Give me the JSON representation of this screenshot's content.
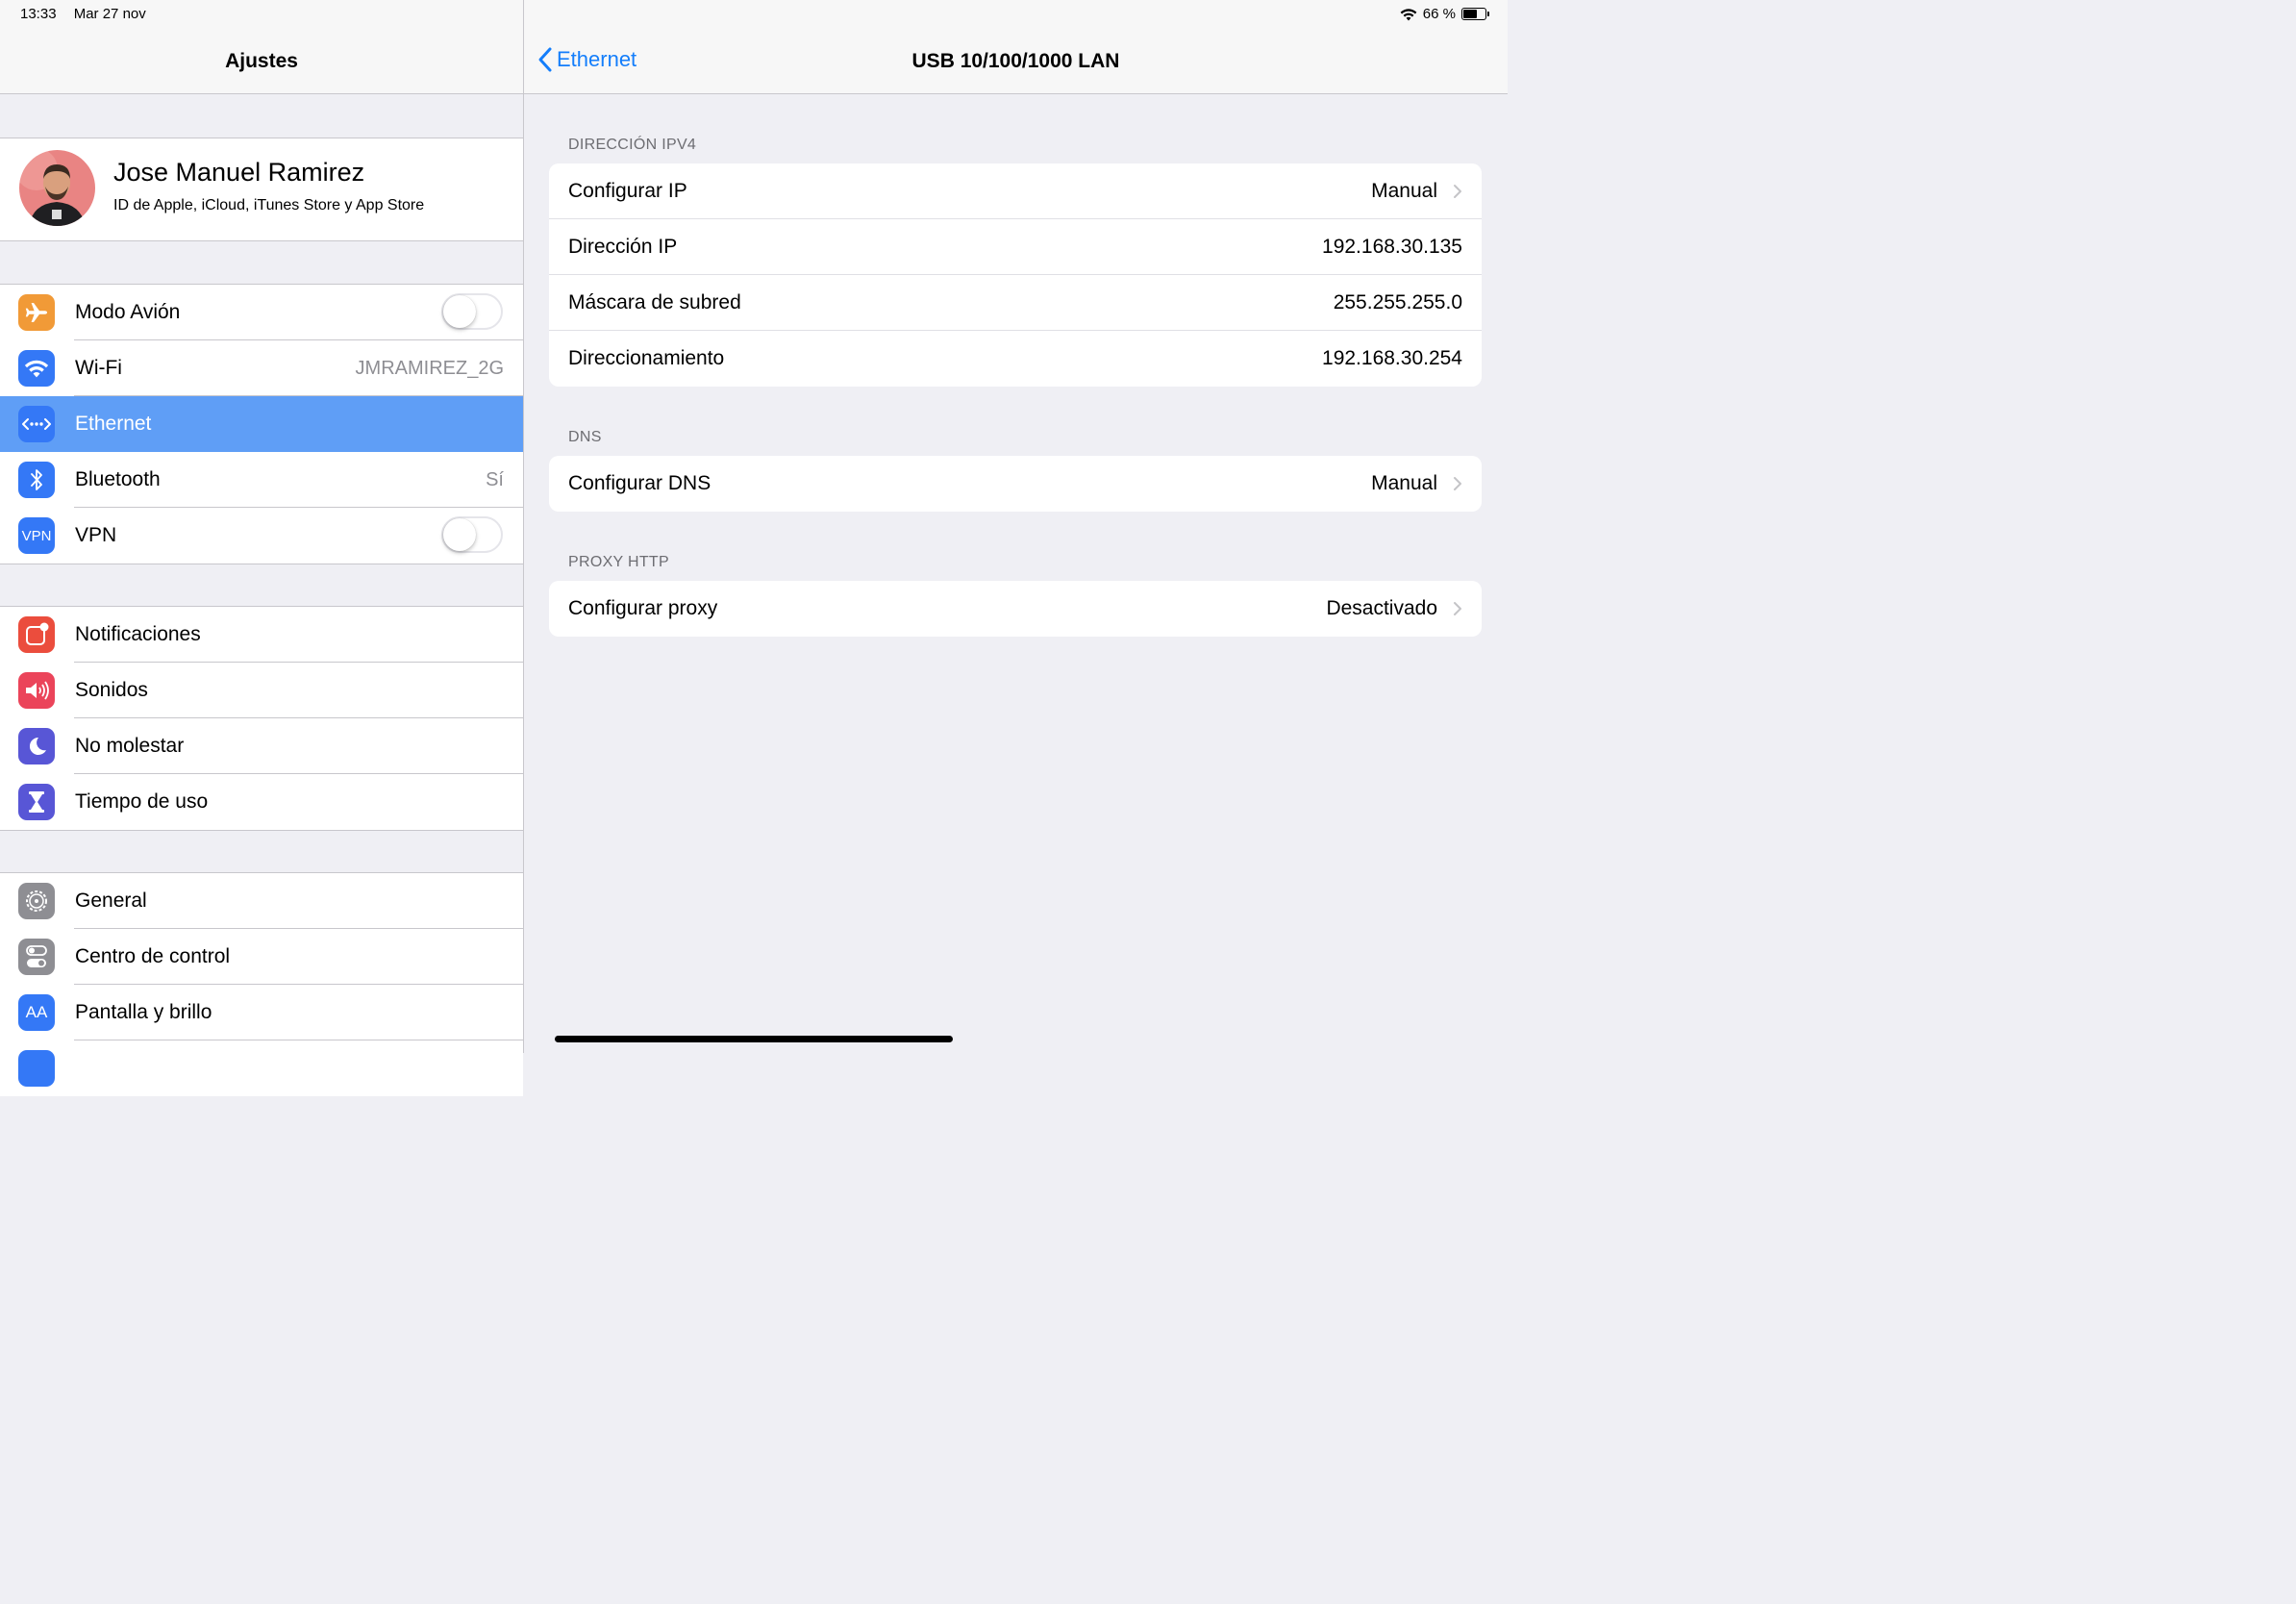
{
  "status": {
    "time": "13:33",
    "date": "Mar 27 nov",
    "battery": "66 %",
    "battery_level": 0.66
  },
  "sidebar": {
    "title": "Ajustes",
    "profile": {
      "name": "Jose Manuel Ramirez",
      "subtitle": "ID de Apple, iCloud, iTunes Store y App Store"
    },
    "groups": [
      [
        {
          "label": "Modo Avión",
          "icon": "airplane-icon",
          "color": "#f19a37",
          "toggle": false
        },
        {
          "label": "Wi-Fi",
          "icon": "wifi-icon",
          "color": "#3478f6",
          "value": "JMRAMIREZ_2G"
        },
        {
          "label": "Ethernet",
          "icon": "ethernet-icon",
          "color": "#3478f6",
          "selected": true
        },
        {
          "label": "Bluetooth",
          "icon": "bluetooth-icon",
          "color": "#3478f6",
          "value": "Sí"
        },
        {
          "label": "VPN",
          "icon": "vpn-icon",
          "color": "#3478f6",
          "icon_text": "VPN",
          "toggle": false
        }
      ],
      [
        {
          "label": "Notificaciones",
          "icon": "notifications-icon",
          "color": "#eb4d3d"
        },
        {
          "label": "Sonidos",
          "icon": "sounds-icon",
          "color": "#eb445a"
        },
        {
          "label": "No molestar",
          "icon": "moon-icon",
          "color": "#5856d6"
        },
        {
          "label": "Tiempo de uso",
          "icon": "hourglass-icon",
          "color": "#5856d6"
        }
      ],
      [
        {
          "label": "General",
          "icon": "gear-icon",
          "color": "#8e8e93"
        },
        {
          "label": "Centro de control",
          "icon": "control-center-icon",
          "color": "#8e8e93"
        },
        {
          "label": "Pantalla y brillo",
          "icon": "display-icon",
          "color": "#3478f6",
          "icon_text": "AA"
        }
      ]
    ]
  },
  "detail": {
    "back_label": "Ethernet",
    "title": "USB 10/100/1000 LAN",
    "sections": [
      {
        "header": "DIRECCIÓN IPV4",
        "rows": [
          {
            "label": "Configurar IP",
            "value": "Manual",
            "chevron": true
          },
          {
            "label": "Dirección IP",
            "value": "192.168.30.135"
          },
          {
            "label": "Máscara de subred",
            "value": "255.255.255.0"
          },
          {
            "label": "Direccionamiento",
            "value": "192.168.30.254"
          }
        ]
      },
      {
        "header": "DNS",
        "rows": [
          {
            "label": "Configurar DNS",
            "value": "Manual",
            "chevron": true
          }
        ]
      },
      {
        "header": "PROXY HTTP",
        "rows": [
          {
            "label": "Configurar proxy",
            "value": "Desactivado",
            "chevron": true
          }
        ]
      }
    ]
  }
}
